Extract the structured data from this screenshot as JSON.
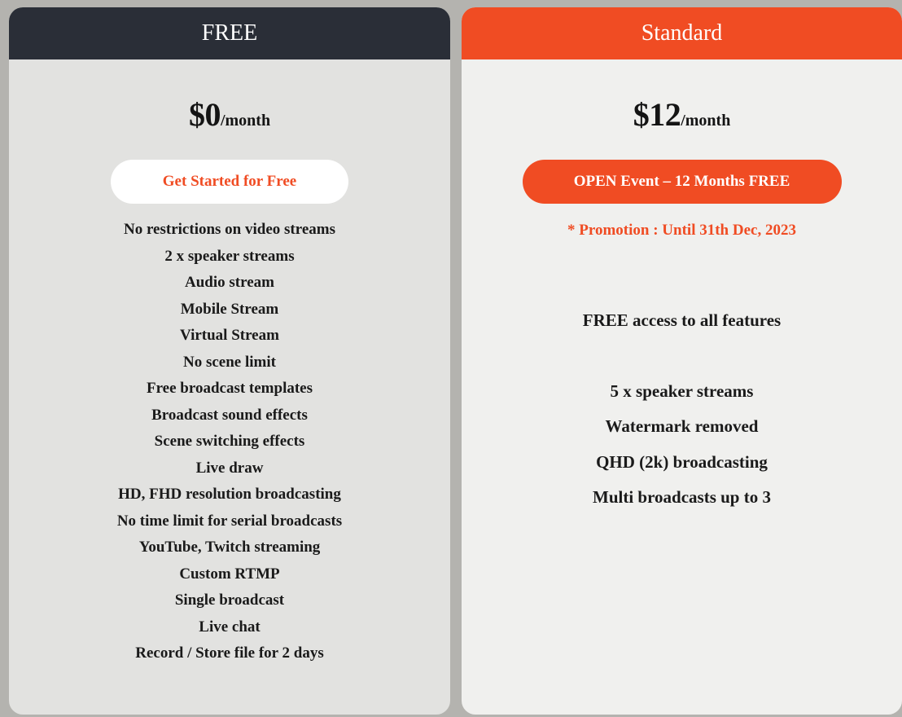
{
  "plans": [
    {
      "name": "FREE",
      "header_color": "#2a2e37",
      "price": "$0",
      "period": "/month",
      "cta_label": "Get Started for Free",
      "features": [
        "No restrictions on video streams",
        "2 x speaker streams",
        "Audio stream",
        "Mobile Stream",
        "Virtual Stream",
        "No scene limit",
        "Free broadcast templates",
        "Broadcast sound effects",
        "Scene switching effects",
        "Live draw",
        "HD, FHD resolution broadcasting",
        "No time limit for serial broadcasts",
        "YouTube, Twitch streaming",
        "Custom RTMP",
        "Single broadcast",
        "Live chat",
        "Record / Store file for 2 days"
      ]
    },
    {
      "name": "Standard",
      "header_color": "#f04c23",
      "price": "$12",
      "period": "/month",
      "cta_label": "OPEN Event – 12 Months FREE",
      "promo_note": "* Promotion : Until 31th Dec, 2023",
      "highlight": "FREE access to all features",
      "features": [
        "5 x speaker streams",
        "Watermark removed",
        "QHD (2k) broadcasting",
        "Multi broadcasts up to 3"
      ]
    }
  ],
  "colors": {
    "accent": "#f04c23",
    "dark": "#2a2e37",
    "background": "#b4b3af"
  }
}
